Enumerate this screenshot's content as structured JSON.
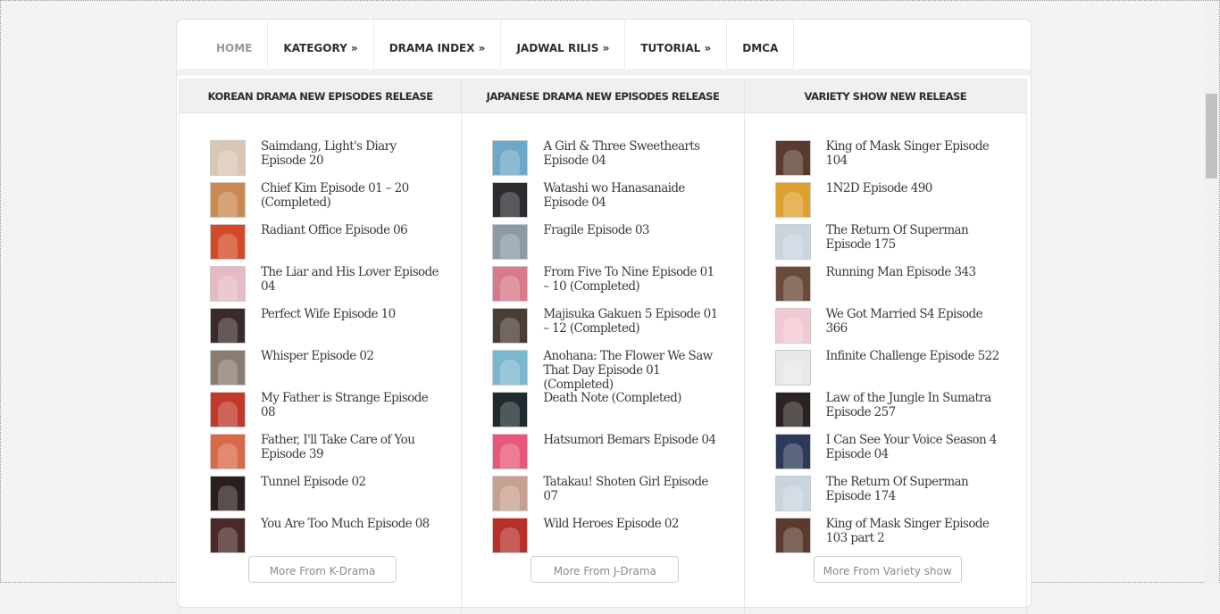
{
  "nav": {
    "items": [
      "HOME",
      "KATEGORY »",
      "DRAMA INDEX »",
      "JADWAL RILIS »",
      "TUTORIAL »",
      "DMCA"
    ]
  },
  "columns": [
    {
      "heading": "KOREAN DRAMA NEW EPISODES RELEASE",
      "more_label": "More From K-Drama",
      "items": [
        {
          "title": "Saimdang, Light's Diary Episode 20",
          "thumb_color": "#d9c7b4"
        },
        {
          "title": "Chief Kim Episode 01 – 20 (Completed)",
          "thumb_color": "#c98a52"
        },
        {
          "title": "Radiant Office Episode 06",
          "thumb_color": "#d4492a"
        },
        {
          "title": "The Liar and His Lover Episode 04",
          "thumb_color": "#e7b9c4"
        },
        {
          "title": "Perfect Wife Episode 10",
          "thumb_color": "#3a2a2a"
        },
        {
          "title": "Whisper Episode 02",
          "thumb_color": "#8a7d70"
        },
        {
          "title": "My Father is Strange Episode 08",
          "thumb_color": "#c0392b"
        },
        {
          "title": "Father, I'll Take Care of You Episode 39",
          "thumb_color": "#d86a4a"
        },
        {
          "title": "Tunnel Episode 02",
          "thumb_color": "#2a1f1c"
        },
        {
          "title": "You Are Too Much Episode 08",
          "thumb_color": "#4a2a28"
        }
      ]
    },
    {
      "heading": "JAPANESE DRAMA NEW EPISODES RELEASE",
      "more_label": "More From J-Drama",
      "items": [
        {
          "title": "A Girl & Three Sweethearts Episode 04",
          "thumb_color": "#6ea8c8"
        },
        {
          "title": "Watashi wo Hanasanaide Episode 04",
          "thumb_color": "#2b2b30"
        },
        {
          "title": "Fragile Episode 03",
          "thumb_color": "#8b9aa6"
        },
        {
          "title": "From Five To Nine Episode 01 – 10 (Completed)",
          "thumb_color": "#d97a8a"
        },
        {
          "title": "Majisuka Gakuen 5 Episode 01 – 12 (Completed)",
          "thumb_color": "#4a3d36"
        },
        {
          "title": "Anohana: The Flower We Saw That Day Episode 01 (Completed)",
          "thumb_color": "#7bb8d0"
        },
        {
          "title": "Death Note (Completed)",
          "thumb_color": "#1e2a2e"
        },
        {
          "title": "Hatsumori Bemars Episode 04",
          "thumb_color": "#e8587a"
        },
        {
          "title": "Tatakau! Shoten Girl Episode 07",
          "thumb_color": "#c8a090"
        },
        {
          "title": "Wild Heroes Episode 02",
          "thumb_color": "#b8302a"
        }
      ]
    },
    {
      "heading": "VARIETY SHOW NEW RELEASE",
      "more_label": "More From Variety show",
      "items": [
        {
          "title": "King of Mask Singer Episode 104",
          "thumb_color": "#5a3a2e"
        },
        {
          "title": "1N2D Episode 490",
          "thumb_color": "#e0a030"
        },
        {
          "title": "The Return Of Superman Episode 175",
          "thumb_color": "#c8d4de"
        },
        {
          "title": "Running Man Episode 343",
          "thumb_color": "#6a4a38"
        },
        {
          "title": "We Got Married S4 Episode 366",
          "thumb_color": "#f2c8d2"
        },
        {
          "title": "Infinite Challenge Episode 522",
          "thumb_color": "#e8e8e8"
        },
        {
          "title": "Law of the Jungle In Sumatra Episode 257",
          "thumb_color": "#2a2220"
        },
        {
          "title": "I Can See Your Voice Season 4 Episode 04",
          "thumb_color": "#2c3a5a"
        },
        {
          "title": "The Return Of Superman Episode 174",
          "thumb_color": "#c8d4de"
        },
        {
          "title": "King of Mask Singer Episode 103 part 2",
          "thumb_color": "#5a3a2e"
        }
      ]
    }
  ]
}
